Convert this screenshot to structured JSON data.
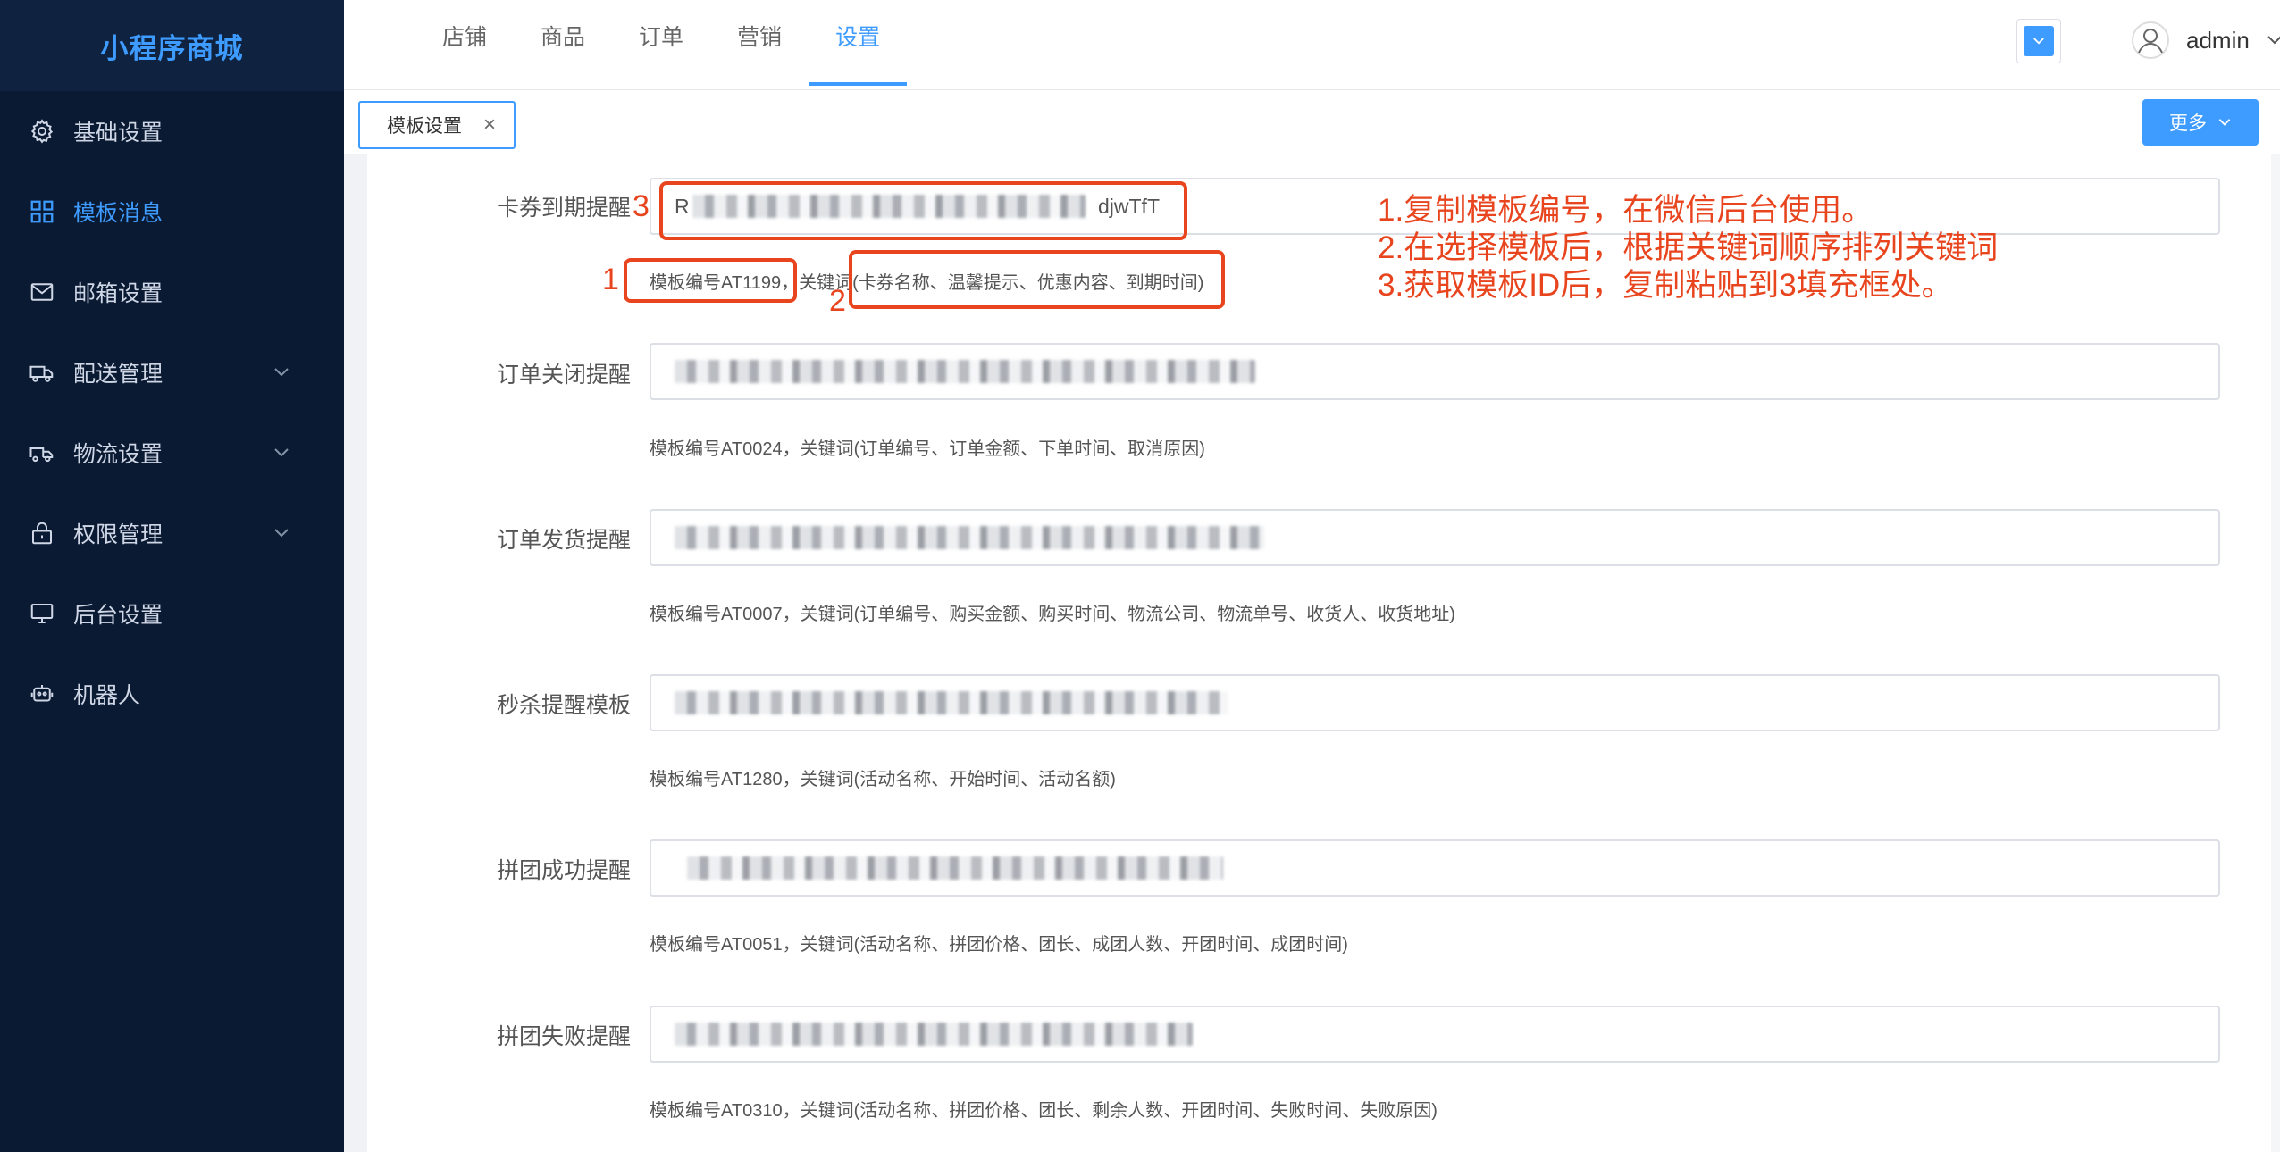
{
  "brand": {
    "title": "小程序商城"
  },
  "sidebar": {
    "items": [
      {
        "label": "基础设置",
        "icon": "gear-icon",
        "active": false,
        "expandable": false
      },
      {
        "label": "模板消息",
        "icon": "grid-icon",
        "active": true,
        "expandable": false
      },
      {
        "label": "邮箱设置",
        "icon": "mail-icon",
        "active": false,
        "expandable": false
      },
      {
        "label": "配送管理",
        "icon": "delivery-icon",
        "active": false,
        "expandable": true
      },
      {
        "label": "物流设置",
        "icon": "truck-icon",
        "active": false,
        "expandable": true
      },
      {
        "label": "权限管理",
        "icon": "lock-icon",
        "active": false,
        "expandable": true
      },
      {
        "label": "后台设置",
        "icon": "monitor-icon",
        "active": false,
        "expandable": false
      },
      {
        "label": "机器人",
        "icon": "robot-icon",
        "active": false,
        "expandable": false
      }
    ]
  },
  "header": {
    "tabs": [
      {
        "label": "店铺",
        "active": false
      },
      {
        "label": "商品",
        "active": false
      },
      {
        "label": "订单",
        "active": false
      },
      {
        "label": "营销",
        "active": false
      },
      {
        "label": "设置",
        "active": true
      }
    ],
    "user": {
      "name": "admin"
    }
  },
  "tagsbar": {
    "tags": [
      {
        "label": "模板设置",
        "close": "×"
      }
    ],
    "more_label": "更多"
  },
  "templates": [
    {
      "label": "卡券到期提醒",
      "value_prefix": "R",
      "value_suffix": "djwTfT",
      "hint": "模板编号AT1199，关键词(卡券名称、温馨提示、优惠内容、到期时间)"
    },
    {
      "label": "订单关闭提醒",
      "value_prefix": "",
      "value_suffix": "",
      "hint": "模板编号AT0024，关键词(订单编号、订单金额、下单时间、取消原因)"
    },
    {
      "label": "订单发货提醒",
      "value_prefix": "",
      "value_suffix": "",
      "hint": "模板编号AT0007，关键词(订单编号、购买金额、购买时间、物流公司、物流单号、收货人、收货地址)"
    },
    {
      "label": "秒杀提醒模板",
      "value_prefix": "",
      "value_suffix": "",
      "hint": "模板编号AT1280，关键词(活动名称、开始时间、活动名额)"
    },
    {
      "label": "拼团成功提醒",
      "value_prefix": "",
      "value_suffix": "",
      "hint": "模板编号AT0051，关键词(活动名称、拼团价格、团长、成团人数、开团时间、成团时间)"
    },
    {
      "label": "拼团失败提醒",
      "value_prefix": "",
      "value_suffix": "",
      "hint": "模板编号AT0310，关键词(活动名称、拼团价格、团长、剩余人数、开团时间、失败时间、失败原因)"
    }
  ],
  "annotations": {
    "markers": [
      "1",
      "2",
      "3"
    ],
    "notes": [
      "1.复制模板编号，在微信后台使用。",
      "2.在选择模板后，根据关键词顺序排列关键词",
      "3.获取模板ID后，复制粘贴到3填充框处。"
    ],
    "color": "#e8451f"
  },
  "colors": {
    "accent": "#3e9bff",
    "sidebar_bg": "#0b1a33"
  }
}
